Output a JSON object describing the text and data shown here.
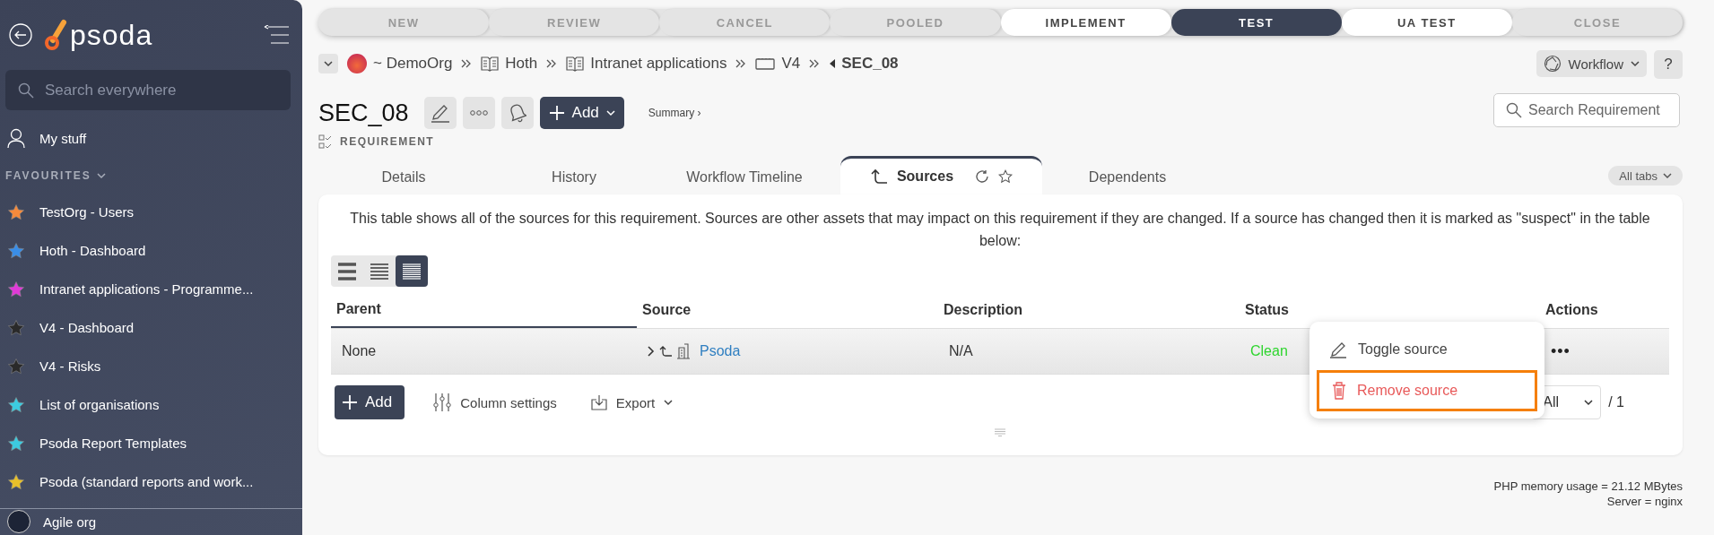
{
  "sidebar": {
    "logo_text": "psoda",
    "search": {
      "placeholder": "Search everywhere"
    },
    "my_stuff": "My stuff",
    "favourites_heading": "FAVOURITES",
    "favourites": [
      {
        "label": "TestOrg - Users",
        "color": "#f58a3c"
      },
      {
        "label": "Hoth - Dashboard",
        "color": "#3a8ee8"
      },
      {
        "label": "Intranet applications - Programme...",
        "color": "#e03ad8"
      },
      {
        "label": "V4 - Dashboard",
        "color": "#2a2a2a"
      },
      {
        "label": "V4 - Risks",
        "color": "#2a2a2a"
      },
      {
        "label": "List of organisations",
        "color": "#3ccbe0"
      },
      {
        "label": "Psoda Report Templates",
        "color": "#3ccbe0"
      },
      {
        "label": "Psoda (standard reports and work...",
        "color": "#e8c02a"
      }
    ],
    "bottom_item": "Agile org"
  },
  "workflow_stages": [
    {
      "label": "NEW",
      "selected": false,
      "disabled": true
    },
    {
      "label": "REVIEW",
      "selected": false,
      "disabled": true
    },
    {
      "label": "CANCEL",
      "selected": false,
      "disabled": true
    },
    {
      "label": "POOLED",
      "selected": false,
      "disabled": true
    },
    {
      "label": "IMPLEMENT",
      "selected": false,
      "disabled": false
    },
    {
      "label": "TEST",
      "selected": true,
      "disabled": false
    },
    {
      "label": "UA TEST",
      "selected": false,
      "disabled": false
    },
    {
      "label": "CLOSE",
      "selected": false,
      "disabled": true
    }
  ],
  "breadcrumb": [
    {
      "label": "~ DemoOrg",
      "kind": "org"
    },
    {
      "label": "Hoth",
      "kind": "book"
    },
    {
      "label": "Intranet applications",
      "kind": "book"
    },
    {
      "label": "V4",
      "kind": "version"
    },
    {
      "label": "SEC_08",
      "kind": "current"
    }
  ],
  "workflow_button": "Workflow",
  "help_button": "?",
  "title": "SEC_08",
  "add_button": "Add",
  "summary_link": "Summary ›",
  "item_type": "REQUIREMENT",
  "search": {
    "placeholder": "Search Requirement"
  },
  "tabs": [
    {
      "label": "Details",
      "selected": false
    },
    {
      "label": "History",
      "selected": false
    },
    {
      "label": "Workflow Timeline",
      "selected": false
    },
    {
      "label": "Sources",
      "selected": true
    },
    {
      "label": "Dependents",
      "selected": false
    }
  ],
  "all_tabs_button": "All tabs",
  "description": "This table shows all of the sources for this requirement. Sources are other assets that may impact on this requirement if they are changed. If a source has changed then it is marked as \"suspect\" in the table below:",
  "view_modes": [
    {
      "kind": "wide",
      "selected": false
    },
    {
      "kind": "medium",
      "selected": false
    },
    {
      "kind": "compact",
      "selected": true
    }
  ],
  "table": {
    "columns": [
      {
        "label": "Parent",
        "sorted": true
      },
      {
        "label": "Source",
        "sorted": false
      },
      {
        "label": "Description",
        "sorted": false
      },
      {
        "label": "Status",
        "sorted": false
      },
      {
        "label": "Actions",
        "sorted": false
      }
    ],
    "rows": [
      {
        "parent": "None",
        "source": "Psoda",
        "description": "N/A",
        "status": "Clean",
        "actions": "•••"
      }
    ]
  },
  "toolbar": {
    "add_button": "Add",
    "column_settings": "Column settings",
    "export": "Export"
  },
  "pagination": {
    "page_size": "All",
    "total": "/ 1"
  },
  "context_menu": [
    {
      "label": "Toggle source",
      "kind": "edit",
      "highlighted": false
    },
    {
      "label": "Remove source",
      "kind": "delete",
      "highlighted": true
    }
  ],
  "footer": [
    "PHP memory usage = 21.12 MBytes",
    "Server = nginx"
  ]
}
